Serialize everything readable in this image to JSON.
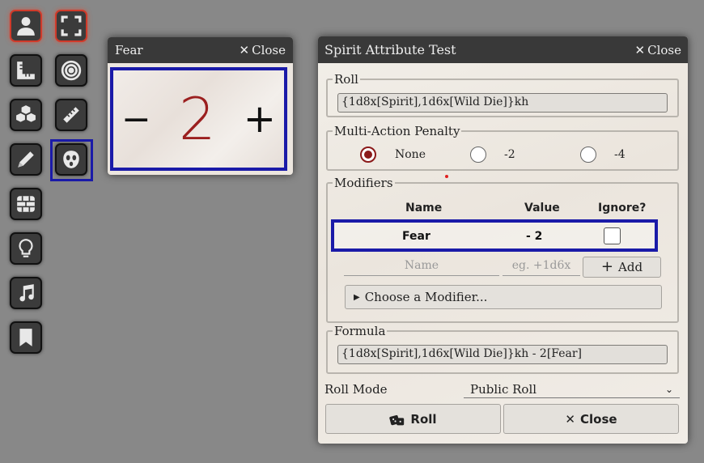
{
  "toolbar": {
    "tools": [
      {
        "icon": "user-icon",
        "active": true
      },
      {
        "icon": "fullscreen-icon",
        "active": true
      },
      {
        "icon": "ruler-square-icon",
        "active": false
      },
      {
        "icon": "target-icon",
        "active": false
      },
      {
        "icon": "cubes-icon",
        "active": false
      },
      {
        "icon": "measure-ruler-icon",
        "active": false
      },
      {
        "icon": "pencil-icon",
        "active": false
      },
      {
        "icon": "fear-mask-icon",
        "active": false,
        "highlighted": true
      },
      {
        "icon": "wall-icon",
        "active": false
      },
      {
        "icon": "lightbulb-icon",
        "active": false
      },
      {
        "icon": "music-icon",
        "active": false
      },
      {
        "icon": "bookmark-icon",
        "active": false
      }
    ]
  },
  "fear_window": {
    "title": "Fear",
    "close_label": "Close",
    "minus": "−",
    "value": "2",
    "plus": "+"
  },
  "dialog": {
    "title": "Spirit Attribute Test",
    "close_label": "Close",
    "roll_legend": "Roll",
    "roll_formula": "{1d8x[Spirit],1d6x[Wild Die]}kh",
    "map_legend": "Multi-Action Penalty",
    "map_options": [
      {
        "label": "None",
        "checked": true
      },
      {
        "label": "-2",
        "checked": false
      },
      {
        "label": "-4",
        "checked": false
      }
    ],
    "modifiers_legend": "Modifiers",
    "modifiers_headers": {
      "name": "Name",
      "value": "Value",
      "ignore": "Ignore?"
    },
    "modifiers_rows": [
      {
        "name": "Fear",
        "value": "- 2",
        "ignore": false
      }
    ],
    "name_placeholder": "Name",
    "value_placeholder": "eg. +1d6x",
    "add_label": "Add",
    "choose_modifier": "Choose a Modifier...",
    "formula_legend": "Formula",
    "formula": "{1d8x[Spirit],1d6x[Wild Die]}kh - 2[Fear]",
    "roll_mode_label": "Roll Mode",
    "roll_mode_value": "Public Roll",
    "roll_button": "Roll",
    "close_button": "Close"
  },
  "colors": {
    "highlight": "#1a1aa8",
    "fear_value": "#9b1f1f",
    "radio_checked": "#8b1a1a",
    "active_tool_border": "#d03a2a"
  }
}
